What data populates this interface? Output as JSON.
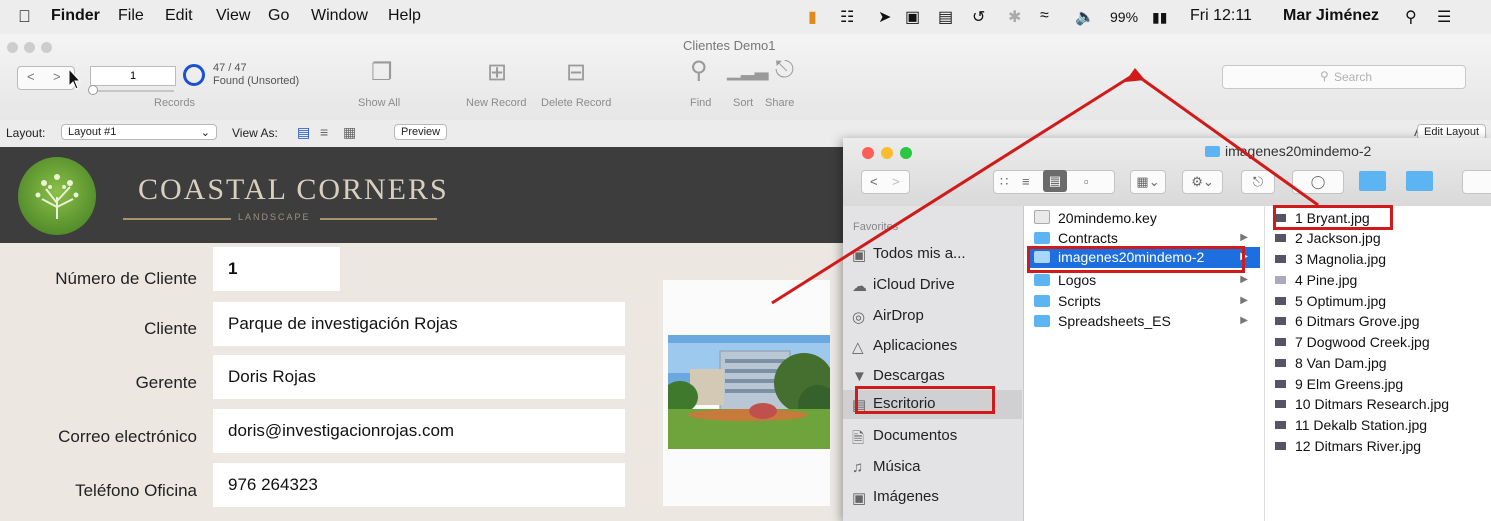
{
  "menubar": {
    "app": "Finder",
    "items": [
      "File",
      "Edit",
      "View",
      "Go",
      "Window",
      "Help"
    ],
    "battery": "99%",
    "clock": "Fri 12:11",
    "user": "Mar Jiménez"
  },
  "filemaker": {
    "window_title": "Clientes Demo1",
    "record_number": "1",
    "records_label": "Records",
    "found_count": "47 / 47",
    "found_status": "Found (Unsorted)",
    "show_all": "Show All",
    "new_record": "New Record",
    "delete_record": "Delete Record",
    "find": "Find",
    "sort": "Sort",
    "share": "Share",
    "search_placeholder": "Search",
    "layout_label": "Layout:",
    "layout_value": "Layout #1",
    "view_as_label": "View As:",
    "preview": "Preview",
    "edit_layout": "Edit Layout",
    "font_icon_text": "Aᵃ",
    "brand": "COASTAL CORNERS",
    "brand_sub": "LANDSCAPE"
  },
  "form": {
    "fields": [
      {
        "label": "Número de Cliente",
        "value": "1"
      },
      {
        "label": "Cliente",
        "value": "Parque de investigación Rojas"
      },
      {
        "label": "Gerente",
        "value": "Doris Rojas"
      },
      {
        "label": "Correo electrónico",
        "value": "doris@investigacionrojas.com"
      },
      {
        "label": "Teléfono Oficina",
        "value": "976 264323"
      }
    ]
  },
  "finder": {
    "title": "imagenes20mindemo-2",
    "sidebar_header": "Favorites",
    "sidebar": [
      "Todos mis a...",
      "iCloud Drive",
      "AirDrop",
      "Aplicaciones",
      "Descargas",
      "Escritorio",
      "Documentos",
      "Música",
      "Imágenes"
    ],
    "column1": [
      "20mindemo.key",
      "Contracts",
      "imagenes20mindemo-2",
      "Logos",
      "Scripts",
      "Spreadsheets_ES"
    ],
    "column2": [
      "1 Bryant.jpg",
      "2 Jackson.jpg",
      "3 Magnolia.jpg",
      "4 Pine.jpg",
      "5 Optimum.jpg",
      "6 Ditmars Grove.jpg",
      "7 Dogwood Creek.jpg",
      "8 Van Dam.jpg",
      "9 Elm Greens.jpg",
      "10 Ditmars Research.jpg",
      "11 Dekalb Station.jpg",
      "12 Ditmars River.jpg"
    ]
  },
  "colors": {
    "annotation_red": "#d11a1a",
    "selection_blue": "#1d6fe0",
    "folder_blue": "#5cb4f2"
  }
}
